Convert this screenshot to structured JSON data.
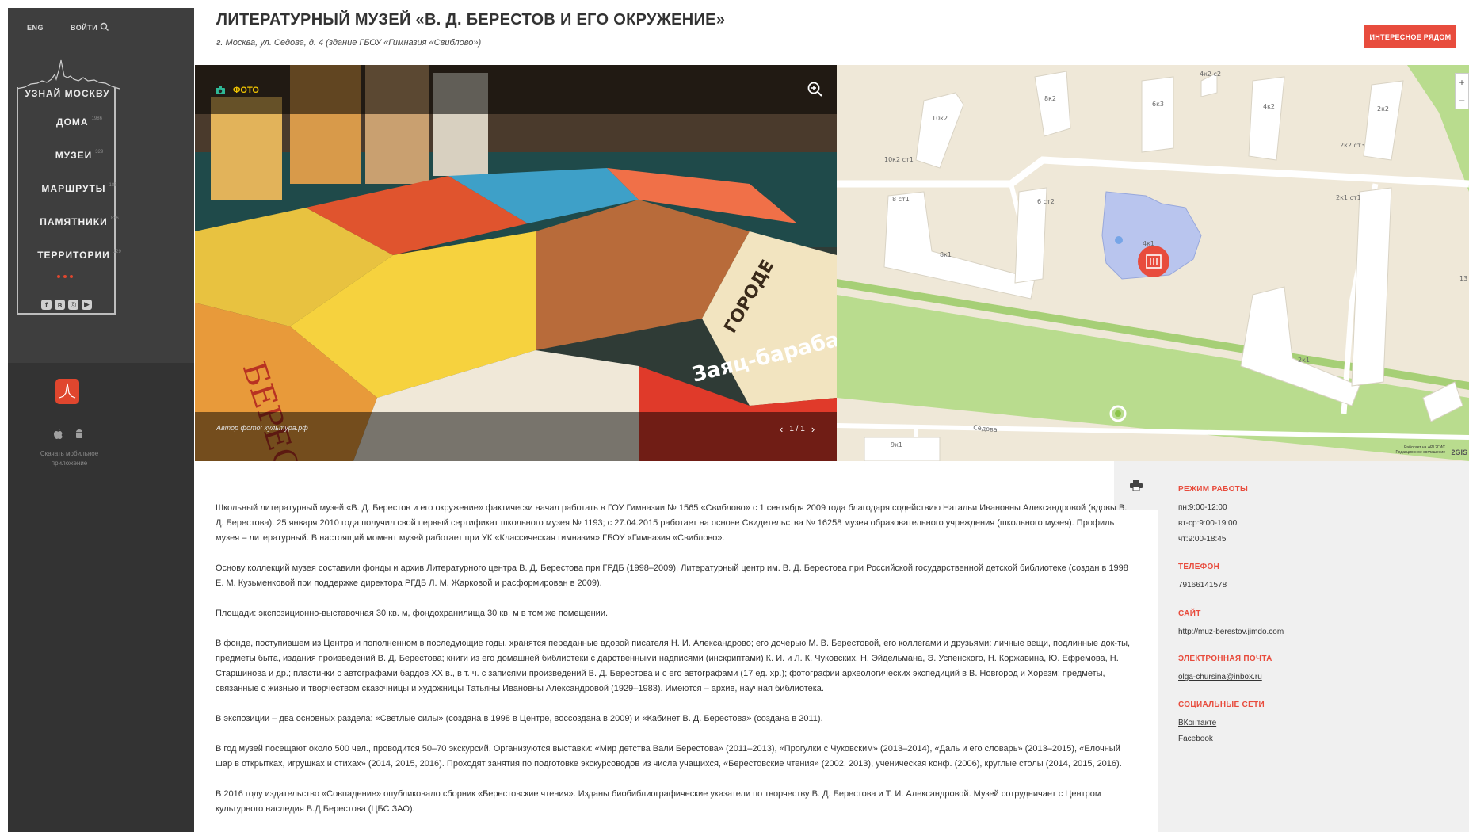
{
  "sidebar": {
    "lang": "ENG",
    "login": "ВОЙТИ",
    "logo_title": "УЗНАЙ МОСКВУ",
    "nav": [
      {
        "label": "ДОМА",
        "count": "1986"
      },
      {
        "label": "МУЗЕИ",
        "count": "329"
      },
      {
        "label": "МАРШРУТЫ",
        "count": "185"
      },
      {
        "label": "ПАМЯТНИКИ",
        "count": "836"
      },
      {
        "label": "ТЕРРИТОРИИ",
        "count": "129"
      }
    ],
    "social": [
      "f",
      "в",
      "◎",
      "▶"
    ],
    "app_text": "Скачать мобильное приложение"
  },
  "header": {
    "title": "ЛИТЕРАТУРНЫЙ МУЗЕЙ «В. Д. БЕРЕСТОВ И ЕГО ОКРУЖЕНИЕ»",
    "address": "г. Москва, ул. Седова, д. 4 (здание ГБОУ «Гимназия «Свиблово»)",
    "nearby_button": "ИНТЕРЕСНОЕ РЯДОМ"
  },
  "photo": {
    "label": "ФОТО",
    "author": "Автор фото: культура.рф",
    "pager": "1 / 1"
  },
  "map": {
    "labels": [
      "10к2",
      "8к2",
      "6к3",
      "4к2",
      "2к2",
      "4к2 с2",
      "10к2 ст1",
      "2к2 ст3",
      "8 ст1",
      "6 ст2",
      "2к1 ст1",
      "8к1",
      "4к1",
      "2к1",
      "9к1",
      "Седова",
      "13"
    ],
    "copyright": "Работает на API 2ГИС\nРедакционное соглашение",
    "brand": "2GIS"
  },
  "content": {
    "paragraphs": [
      "Школьный литературный музей «В. Д. Берестов и его окружение» фактически начал работать в ГОУ Гимназии № 1565 «Свиблово» с 1 сентября 2009 года благодаря содействию Натальи Ивановны Александровой (вдовы В. Д. Берестова). 25 января 2010 года получил свой первый сертификат школьного музея № 1193; с 27.04.2015 работает на основе Свидетельства № 16258 музея образовательного учреждения (школьного музея). Профиль музея – литературный. В настоящий момент музей работает при УК «Классическая гимназия» ГБОУ «Гимназия «Свиблово».",
      "Основу коллекций музея составили фонды и архив Литературного центра В. Д. Берестова при ГРДБ (1998–2009). Литературный центр им. В. Д. Берестова при Российской государственной детской библиотеке (создан в 1998 Е. М. Кузьменковой при поддержке директора РГДБ Л. М. Жарковой и расформирован в 2009).",
      "Площади: экспозиционно-выставочная 30 кв. м, фондохранилища 30 кв. м в том же помещении.",
      "В фонде, поступившем из Центра и пополненном в последующие годы, хранятся переданные вдовой писателя Н. И. Александрово; его дочерью М. В. Берестовой, его коллегами и друзьями: личные вещи, подлинные док-ты, предметы быта, издания произведений В. Д. Берестова; книги из его домашней библиотеки с дарственными надписями (инскриптами) К. И. и Л. К. Чуковских, Н. Эйдельмана, Э. Успенского, Н. Коржавина, Ю. Ефремова, Н. Старшинова и др.; пластинки с автографами бардов XX в., в т. ч. с записями произведений В. Д. Берестова и с его автографами (17 ед. хр.); фотографии археологических экспедиций в В. Новгород и Хорезм; предметы, связанные с жизнью и творчеством сказочницы и художницы Татьяны Ивановны Александровой (1929–1983). Имеются – архив, научная библиотека.",
      "В экспозиции – два основных раздела: «Светлые силы» (создана в 1998 в Центре, воссоздана в 2009) и «Кабинет В. Д. Берестова» (создана в 2011).",
      "В год музей посещают около 500 чел., проводится 50–70 экскурсий. Организуются выставки: «Мир детства Вали Берестова» (2011–2013), «Прогулки с Чуковским» (2013–2014), «Даль и его словарь» (2013–2015), «Елочный шар в открытках, игрушках и стихах» (2014, 2015, 2016). Проходят занятия по подготовке экскурсоводов из числа учащихся, «Берестовские чтения» (2002, 2013), ученическая конф. (2006), круглые столы (2014, 2015, 2016).",
      "В 2016 году издательство «Совпадение» опубликовало сборник «Берестовские чтения». Изданы биобиблиографические указатели по творчеству В. Д. Берестова и Т. И. Александровой. Музей сотрудничает с Центром культурного наследия В.Д.Берестова (ЦБС ЗАО)."
    ]
  },
  "info": {
    "hours_title": "РЕЖИМ РАБОТЫ",
    "hours": [
      "пн:9:00-12:00",
      "вт-ср:9:00-19:00",
      "чт:9:00-18:45"
    ],
    "phone_title": "ТЕЛЕФОН",
    "phone": "79166141578",
    "site_title": "САЙТ",
    "site": "http://muz-berestov.jimdo.com",
    "email_title": "ЭЛЕКТРОННАЯ ПОЧТА",
    "email": "olga-chursina@inbox.ru",
    "social_title": "СОЦИАЛЬНЫЕ СЕТИ",
    "social": [
      "ВКонтакте",
      "Facebook"
    ]
  },
  "colors": {
    "accent": "#e84c3d",
    "sidebar_bg": "#3e3e3e",
    "photo_label": "#f0c400"
  }
}
